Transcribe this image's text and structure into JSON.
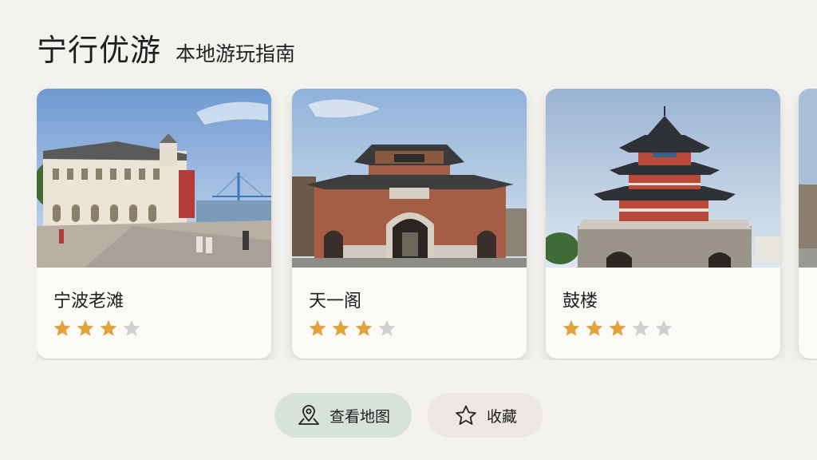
{
  "header": {
    "title": "宁行优游",
    "subtitle": "本地游玩指南"
  },
  "cards": [
    {
      "name": "宁波老滩",
      "rating": 3,
      "max": 4,
      "image": "waterfront-colonial-building"
    },
    {
      "name": "天一阁",
      "rating": 3,
      "max": 4,
      "image": "chinese-brick-gate"
    },
    {
      "name": "鼓楼",
      "rating": 3,
      "max": 5,
      "image": "drum-tower-pagoda"
    }
  ],
  "actions": {
    "map_label": "查看地图",
    "fav_label": "收藏"
  },
  "icons": {
    "map": "map-pin-icon",
    "fav": "star-outline-icon"
  },
  "colors": {
    "star_filled": "#e3a33c",
    "star_empty": "#cfcfcf",
    "map_btn": "#d8e2db",
    "fav_btn": "#ebe8e3",
    "background": "#f3f2ee"
  }
}
